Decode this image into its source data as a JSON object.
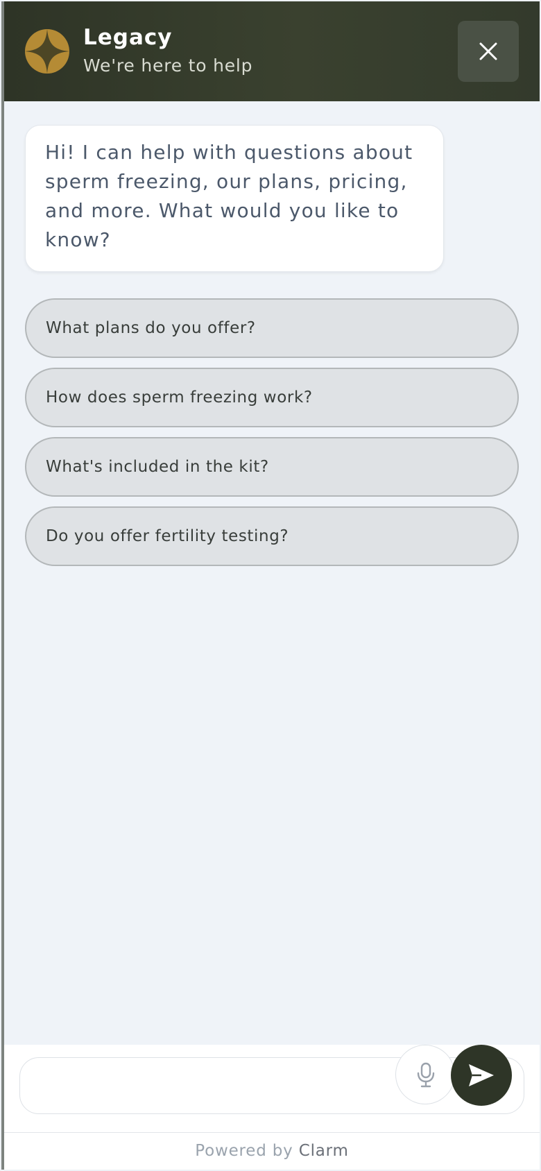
{
  "header": {
    "title": "Legacy",
    "subtitle": "We're here to help",
    "close_icon": "close-icon",
    "logo_icon": "four-point-star-logo"
  },
  "messages": [
    {
      "role": "assistant",
      "text": "Hi! I can help with questions about sperm freezing, our plans, pricing, and more. What would you like to know?"
    }
  ],
  "suggestions": [
    "What plans do you offer?",
    "How does sperm freezing work?",
    "What's included in the kit?",
    "Do you offer fertility testing?"
  ],
  "composer": {
    "value": "",
    "placeholder": "",
    "mic_icon": "microphone-icon",
    "send_icon": "send-icon"
  },
  "footer": {
    "powered_prefix": "Powered by",
    "brand": "Clarm"
  },
  "colors": {
    "header_bg": "#333a2c",
    "logo": "#b58b35",
    "chip_bg": "#dfe2e5",
    "send_button": "#2e3527",
    "background": "#eff3f8"
  }
}
